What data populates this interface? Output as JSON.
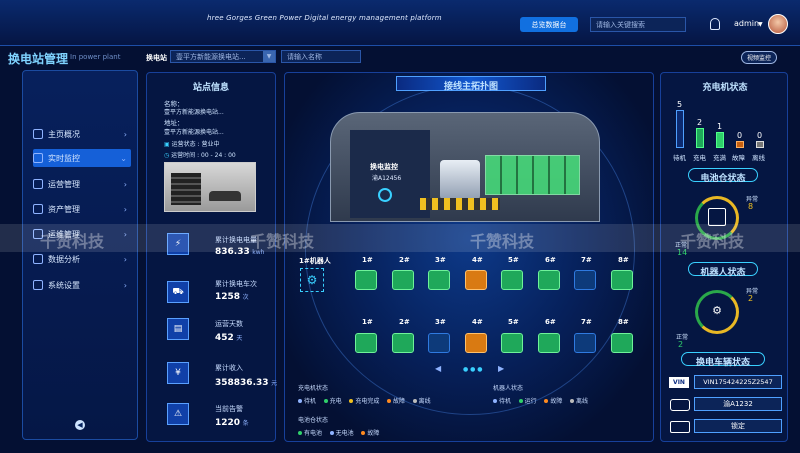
{
  "header": {
    "platform": "hree Gorges Green Power Digital energy management platform",
    "dashboard_btn": "总览数据台",
    "search_placeholder": "请输入关键搜索",
    "user": "admin",
    "video_btn": "视频监控"
  },
  "app": {
    "title": "换电站管理",
    "subtitle": "In power plant"
  },
  "filters": {
    "station_label": "换电站",
    "station_value": "壹平方新能源换电站...",
    "name_placeholder": "请输入名称"
  },
  "sidebar": {
    "items": [
      {
        "label": "主页概况"
      },
      {
        "label": "实时监控"
      },
      {
        "label": "运营管理"
      },
      {
        "label": "资产管理"
      },
      {
        "label": "运维管理"
      },
      {
        "label": "数据分析"
      },
      {
        "label": "系统设置"
      }
    ]
  },
  "station": {
    "title": "站点信息",
    "name_label": "名称：",
    "name_value": "壹平方新能源换电站...",
    "addr_label": "地址：",
    "addr_value": "壹平方新能源换电站...",
    "status_label": "运营状态",
    "status_value": "营业中",
    "time_label": "运营时间",
    "time_value": "00 - 24 : 00"
  },
  "stats": [
    {
      "label": "累计换电电量",
      "value": "836.33",
      "unit": "kwh"
    },
    {
      "label": "累计换电车次",
      "value": "1258",
      "unit": "次"
    },
    {
      "label": "运营天数",
      "value": "452",
      "unit": "天"
    },
    {
      "label": "累计收入",
      "value": "358836.33",
      "unit": "元"
    },
    {
      "label": "当前告警",
      "value": "1220",
      "unit": "条"
    }
  ],
  "topology": {
    "title": "接线主拓扑图",
    "plate_title": "换电监控",
    "plate_no": "渝A12456",
    "robot_label": "1#机器人",
    "bays": [
      "1#",
      "2#",
      "3#",
      "4#",
      "5#",
      "6#",
      "7#",
      "8#"
    ]
  },
  "legend": {
    "charger_title": "充电机状态",
    "charger": [
      "待机",
      "充电",
      "充电完成",
      "故障",
      "离线"
    ],
    "robot_title": "机器人状态",
    "robot": [
      "待机",
      "运行",
      "故障",
      "离线"
    ],
    "battery_title": "电池仓状态",
    "battery": [
      "有电池",
      "无电池",
      "故障"
    ]
  },
  "charger_status": {
    "title": "充电机状态",
    "items": [
      {
        "n": "5",
        "label": "待机"
      },
      {
        "n": "2",
        "label": "充电"
      },
      {
        "n": "1",
        "label": "充满"
      },
      {
        "n": "0",
        "label": "故障"
      },
      {
        "n": "0",
        "label": "离线"
      }
    ]
  },
  "battery_status": {
    "title": "电池仓状态",
    "abn_label": "异常",
    "abn_value": "8",
    "ok_label": "正常",
    "ok_value": "14"
  },
  "robot_status": {
    "title": "机器人状态",
    "abn_label": "异常",
    "abn_value": "2",
    "ok_label": "正常",
    "ok_value": "2"
  },
  "vehicle_status": {
    "title": "换电车辆状态",
    "vin_tag": "VIN",
    "vin_value": "VIN175424225Z2547",
    "plate": "渝A1232",
    "lock": "锁定"
  },
  "watermark": "千赞科技"
}
